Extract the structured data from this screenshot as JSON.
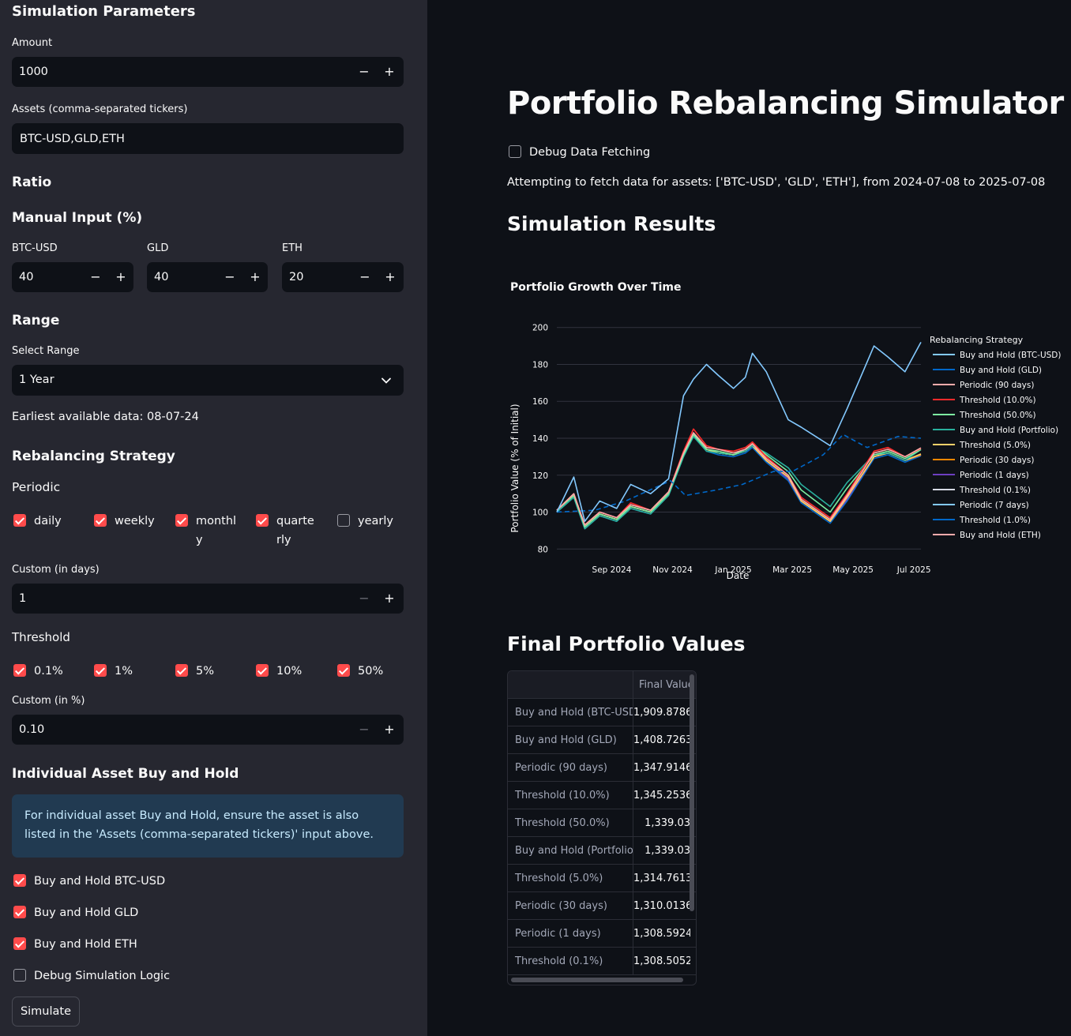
{
  "sidebar": {
    "title": "Simulation Parameters",
    "amount_label": "Amount",
    "amount_value": "1000",
    "assets_label": "Assets (comma-separated tickers)",
    "assets_value": "BTC-USD,GLD,ETH",
    "ratio_heading": "Ratio",
    "manual_heading": "Manual Input (%)",
    "ratios": [
      {
        "label": "BTC-USD",
        "value": "40"
      },
      {
        "label": "GLD",
        "value": "40"
      },
      {
        "label": "ETH",
        "value": "20"
      }
    ],
    "range_heading": "Range",
    "select_range_label": "Select Range",
    "select_range_value": "1 Year",
    "earliest_text": "Earliest available data: 08-07-24",
    "strategy_heading": "Rebalancing Strategy",
    "periodic_label": "Periodic",
    "periodic_options": [
      {
        "label": "daily",
        "checked": true
      },
      {
        "label": "weekly",
        "checked": true
      },
      {
        "label_line1": "monthl",
        "label_line2": "y",
        "checked": true
      },
      {
        "label_line1": "quarte",
        "label_line2": "rly",
        "checked": true
      },
      {
        "label": "yearly",
        "checked": false
      }
    ],
    "custom_days_label": "Custom (in days)",
    "custom_days_value": "1",
    "threshold_label": "Threshold",
    "threshold_options": [
      {
        "label": "0.1%",
        "checked": true
      },
      {
        "label": "1%",
        "checked": true
      },
      {
        "label": "5%",
        "checked": true
      },
      {
        "label": "10%",
        "checked": true
      },
      {
        "label": "50%",
        "checked": true
      }
    ],
    "custom_pct_label": "Custom (in %)",
    "custom_pct_value": "0.10",
    "individual_heading": "Individual Asset Buy and Hold",
    "info_text": "For individual asset Buy and Hold, ensure the asset is also listed in the 'Assets (comma-separated tickers)' input above.",
    "bh_options": [
      {
        "label": "Buy and Hold BTC-USD",
        "checked": true
      },
      {
        "label": "Buy and Hold GLD",
        "checked": true
      },
      {
        "label": "Buy and Hold ETH",
        "checked": true
      },
      {
        "label": "Debug Simulation Logic",
        "checked": false
      }
    ],
    "simulate_label": "Simulate",
    "minus": "−",
    "plus": "+"
  },
  "main": {
    "title": "Portfolio Rebalancing Simulator",
    "debug_label": "Debug Data Fetching",
    "fetch_text": "Attempting to fetch data for assets: ['BTC-USD', 'GLD', 'ETH'], from 2024-07-08 to 2025-07-08",
    "results_heading": "Simulation Results",
    "final_heading": "Final Portfolio Values",
    "table": {
      "header": "Final Value",
      "rows": [
        {
          "name": "Buy and Hold (BTC-USD)",
          "value": "1,909.8786"
        },
        {
          "name": "Buy and Hold (GLD)",
          "value": "1,408.7263"
        },
        {
          "name": "Periodic (90 days)",
          "value": "1,347.9146"
        },
        {
          "name": "Threshold (10.0%)",
          "value": "1,345.2536"
        },
        {
          "name": "Threshold (50.0%)",
          "value": "1,339.03"
        },
        {
          "name": "Buy and Hold (Portfolio)",
          "value": "1,339.03"
        },
        {
          "name": "Threshold (5.0%)",
          "value": "1,314.7613"
        },
        {
          "name": "Periodic (30 days)",
          "value": "1,310.0136"
        },
        {
          "name": "Periodic (1 days)",
          "value": "1,308.5924"
        },
        {
          "name": "Threshold (0.1%)",
          "value": "1,308.5052"
        }
      ]
    }
  },
  "chart_data": {
    "type": "line",
    "title": "Portfolio Growth Over Time",
    "xlabel": "Date",
    "ylabel": "Portfolio Value (% of Initial)",
    "ylim": [
      75,
      205
    ],
    "yticks": [
      80,
      100,
      120,
      140,
      160,
      180,
      200
    ],
    "xlim": [
      "2024-07-08",
      "2025-07-08"
    ],
    "xticks": [
      {
        "date": "2024-09-01",
        "label": "Sep 2024"
      },
      {
        "date": "2024-11-01",
        "label": "Nov 2024"
      },
      {
        "date": "2025-01-01",
        "label": "Jan 2025"
      },
      {
        "date": "2025-03-01",
        "label": "Mar 2025"
      },
      {
        "date": "2025-05-01",
        "label": "May 2025"
      },
      {
        "date": "2025-07-01",
        "label": "Jul 2025"
      }
    ],
    "legend_title": "Rebalancing Strategy",
    "legend_position": "right",
    "grid": true,
    "series": [
      {
        "name": "Buy and Hold (BTC-USD)",
        "color": "#83c9ff",
        "dates": [
          "2024-07-08",
          "2024-07-25",
          "2024-08-05",
          "2024-08-20",
          "2024-09-06",
          "2024-09-20",
          "2024-10-10",
          "2024-10-28",
          "2024-11-12",
          "2024-11-22",
          "2024-12-05",
          "2024-12-17",
          "2025-01-01",
          "2025-01-13",
          "2025-01-20",
          "2025-02-03",
          "2025-02-25",
          "2025-03-10",
          "2025-04-08",
          "2025-04-25",
          "2025-05-22",
          "2025-06-05",
          "2025-06-22",
          "2025-07-08"
        ],
        "values": [
          100,
          119,
          95,
          106,
          102,
          115,
          110,
          118,
          163,
          172,
          180,
          174,
          167,
          173,
          186,
          176,
          150,
          146,
          136,
          156,
          190,
          184,
          176,
          192
        ]
      },
      {
        "name": "Buy and Hold (GLD)",
        "color": "#0068c9",
        "dashed": true,
        "dates": [
          "2024-07-08",
          "2024-08-15",
          "2024-09-15",
          "2024-10-01",
          "2024-10-30",
          "2024-11-14",
          "2024-12-15",
          "2025-01-10",
          "2025-02-10",
          "2025-03-01",
          "2025-04-01",
          "2025-04-21",
          "2025-05-15",
          "2025-06-15",
          "2025-07-08"
        ],
        "values": [
          100,
          101,
          106,
          110,
          117,
          109,
          112,
          115,
          122,
          122,
          131,
          142,
          135,
          141,
          140
        ]
      },
      {
        "name": "Periodic (90 days)",
        "color": "#ffabab",
        "dates": [
          "2024-07-08",
          "2024-07-25",
          "2024-08-05",
          "2024-08-20",
          "2024-09-06",
          "2024-09-20",
          "2024-10-10",
          "2024-10-28",
          "2024-11-12",
          "2024-11-22",
          "2024-12-05",
          "2024-12-17",
          "2025-01-01",
          "2025-01-13",
          "2025-01-20",
          "2025-02-03",
          "2025-02-25",
          "2025-03-10",
          "2025-04-08",
          "2025-04-25",
          "2025-05-22",
          "2025-06-05",
          "2025-06-22",
          "2025-07-08"
        ],
        "values": [
          101,
          110,
          93,
          100,
          97,
          104,
          101,
          111,
          132,
          143,
          135,
          134,
          132,
          134,
          137,
          129,
          120,
          107,
          96,
          109,
          132,
          134,
          130,
          134.8
        ]
      },
      {
        "name": "Threshold (10.0%)",
        "color": "#ff2b2b",
        "dates": [
          "2024-07-08",
          "2024-07-25",
          "2024-08-05",
          "2024-08-20",
          "2024-09-06",
          "2024-09-20",
          "2024-10-10",
          "2024-10-28",
          "2024-11-12",
          "2024-11-22",
          "2024-12-05",
          "2024-12-17",
          "2025-01-01",
          "2025-01-13",
          "2025-01-20",
          "2025-02-03",
          "2025-02-25",
          "2025-03-10",
          "2025-04-08",
          "2025-04-25",
          "2025-05-22",
          "2025-06-05",
          "2025-06-22",
          "2025-07-08"
        ],
        "values": [
          101,
          110,
          93,
          100,
          97,
          105,
          101,
          111,
          133,
          145,
          136,
          134,
          133,
          135,
          138,
          130,
          120,
          108,
          97,
          110,
          133,
          135,
          130,
          134.5
        ]
      },
      {
        "name": "Threshold (50.0%)",
        "color": "#7defa1",
        "dates": [
          "2024-07-08",
          "2024-07-25",
          "2024-08-05",
          "2024-08-20",
          "2024-09-06",
          "2024-09-20",
          "2024-10-10",
          "2024-10-28",
          "2024-11-12",
          "2024-11-22",
          "2024-12-05",
          "2024-12-17",
          "2025-01-01",
          "2025-01-13",
          "2025-01-20",
          "2025-02-03",
          "2025-02-25",
          "2025-03-10",
          "2025-04-08",
          "2025-04-25",
          "2025-05-22",
          "2025-06-05",
          "2025-06-22",
          "2025-07-08"
        ],
        "values": [
          101,
          109,
          92,
          99,
          96,
          103,
          100,
          110,
          131,
          142,
          134,
          133,
          131,
          134,
          137,
          131,
          122,
          112,
          100,
          113,
          131,
          133,
          129,
          133.9
        ]
      },
      {
        "name": "Buy and Hold (Portfolio)",
        "color": "#29b09d",
        "dates": [
          "2024-07-08",
          "2024-07-25",
          "2024-08-05",
          "2024-08-20",
          "2024-09-06",
          "2024-09-20",
          "2024-10-10",
          "2024-10-28",
          "2024-11-12",
          "2024-11-22",
          "2024-12-05",
          "2024-12-17",
          "2025-01-01",
          "2025-01-13",
          "2025-01-20",
          "2025-02-03",
          "2025-02-25",
          "2025-03-10",
          "2025-04-08",
          "2025-04-25",
          "2025-05-22",
          "2025-06-05",
          "2025-06-22",
          "2025-07-08"
        ],
        "values": [
          100,
          108,
          91,
          98,
          95,
          102,
          99,
          109,
          130,
          141,
          133,
          132,
          131,
          133,
          136,
          132,
          124,
          115,
          103,
          116,
          131,
          132,
          128,
          133.9
        ]
      },
      {
        "name": "Threshold (5.0%)",
        "color": "#ffd16a",
        "dates": [
          "2024-07-08",
          "2024-07-25",
          "2024-08-05",
          "2024-08-20",
          "2024-09-06",
          "2024-09-20",
          "2024-10-10",
          "2024-10-28",
          "2024-11-12",
          "2024-11-22",
          "2024-12-05",
          "2024-12-17",
          "2025-01-01",
          "2025-01-13",
          "2025-01-20",
          "2025-02-03",
          "2025-02-25",
          "2025-03-10",
          "2025-04-08",
          "2025-04-25",
          "2025-05-22",
          "2025-06-05",
          "2025-06-22",
          "2025-07-08"
        ],
        "values": [
          101,
          109,
          92,
          99,
          96,
          103,
          100,
          110,
          131,
          142,
          134,
          132,
          131,
          133,
          136,
          128,
          119,
          106,
          95,
          108,
          130,
          132,
          128,
          131.5
        ]
      },
      {
        "name": "Periodic (30 days)",
        "color": "#ff8700",
        "dates": [
          "2024-07-08",
          "2024-07-25",
          "2024-08-05",
          "2024-08-20",
          "2024-09-06",
          "2024-09-20",
          "2024-10-10",
          "2024-10-28",
          "2024-11-12",
          "2024-11-22",
          "2024-12-05",
          "2024-12-17",
          "2025-01-01",
          "2025-01-13",
          "2025-01-20",
          "2025-02-03",
          "2025-02-25",
          "2025-03-10",
          "2025-04-08",
          "2025-04-25",
          "2025-05-22",
          "2025-06-05",
          "2025-06-22",
          "2025-07-08"
        ],
        "values": [
          101,
          109,
          92,
          99,
          96,
          103,
          100,
          110,
          131,
          142,
          134,
          132,
          131,
          133,
          136,
          128,
          119,
          106,
          95,
          108,
          130,
          132,
          128,
          131
        ]
      },
      {
        "name": "Periodic (1 days)",
        "color": "#6d3fc0",
        "dates": [
          "2024-07-08",
          "2024-07-25",
          "2024-08-05",
          "2024-08-20",
          "2024-09-06",
          "2024-09-20",
          "2024-10-10",
          "2024-10-28",
          "2024-11-12",
          "2024-11-22",
          "2024-12-05",
          "2024-12-17",
          "2025-01-01",
          "2025-01-13",
          "2025-01-20",
          "2025-02-03",
          "2025-02-25",
          "2025-03-10",
          "2025-04-08",
          "2025-04-25",
          "2025-05-22",
          "2025-06-05",
          "2025-06-22",
          "2025-07-08"
        ],
        "values": [
          101,
          109,
          92,
          99,
          96,
          103,
          100,
          110,
          131,
          142,
          134,
          132,
          131,
          133,
          136,
          128,
          118,
          106,
          95,
          107,
          130,
          132,
          128,
          130.9
        ]
      },
      {
        "name": "Threshold (0.1%)",
        "color": "#d5dae5",
        "dates": [
          "2024-07-08",
          "2024-07-25",
          "2024-08-05",
          "2024-08-20",
          "2024-09-06",
          "2024-09-20",
          "2024-10-10",
          "2024-10-28",
          "2024-11-12",
          "2024-11-22",
          "2024-12-05",
          "2024-12-17",
          "2025-01-01",
          "2025-01-13",
          "2025-01-20",
          "2025-02-03",
          "2025-02-25",
          "2025-03-10",
          "2025-04-08",
          "2025-04-25",
          "2025-05-22",
          "2025-06-05",
          "2025-06-22",
          "2025-07-08"
        ],
        "values": [
          101,
          109,
          92,
          99,
          96,
          103,
          100,
          110,
          131,
          142,
          134,
          132,
          131,
          133,
          136,
          128,
          118,
          106,
          95,
          107,
          130,
          132,
          128,
          130.9
        ]
      },
      {
        "name": "Periodic (7 days)",
        "color": "#83c9ff",
        "dates": [
          "2024-07-08",
          "2024-07-25",
          "2024-08-05",
          "2024-08-20",
          "2024-09-06",
          "2024-09-20",
          "2024-10-10",
          "2024-10-28",
          "2024-11-12",
          "2024-11-22",
          "2024-12-05",
          "2024-12-17",
          "2025-01-01",
          "2025-01-13",
          "2025-01-20",
          "2025-02-03",
          "2025-02-25",
          "2025-03-10",
          "2025-04-08",
          "2025-04-25",
          "2025-05-22",
          "2025-06-05",
          "2025-06-22",
          "2025-07-08"
        ],
        "values": [
          101,
          109,
          92,
          99,
          96,
          103,
          100,
          110,
          131,
          142,
          134,
          132,
          131,
          133,
          136,
          128,
          118,
          106,
          95,
          107,
          130,
          132,
          128,
          131
        ]
      },
      {
        "name": "Threshold (1.0%)",
        "color": "#0068c9",
        "dates": [
          "2024-07-08",
          "2024-07-25",
          "2024-08-05",
          "2024-08-20",
          "2024-09-06",
          "2024-09-20",
          "2024-10-10",
          "2024-10-28",
          "2024-11-12",
          "2024-11-22",
          "2024-12-05",
          "2024-12-17",
          "2025-01-01",
          "2025-01-13",
          "2025-01-20",
          "2025-02-03",
          "2025-02-25",
          "2025-03-10",
          "2025-04-08",
          "2025-04-25",
          "2025-05-22",
          "2025-06-05",
          "2025-06-22",
          "2025-07-08"
        ],
        "values": [
          100,
          108,
          91,
          98,
          95,
          102,
          99,
          109,
          130,
          141,
          133,
          131,
          130,
          132,
          135,
          127,
          117,
          105,
          94,
          106,
          129,
          131,
          127,
          130.5
        ]
      },
      {
        "name": "Buy and Hold (ETH)",
        "color": "#ffabab",
        "dates": [],
        "values": []
      }
    ]
  }
}
